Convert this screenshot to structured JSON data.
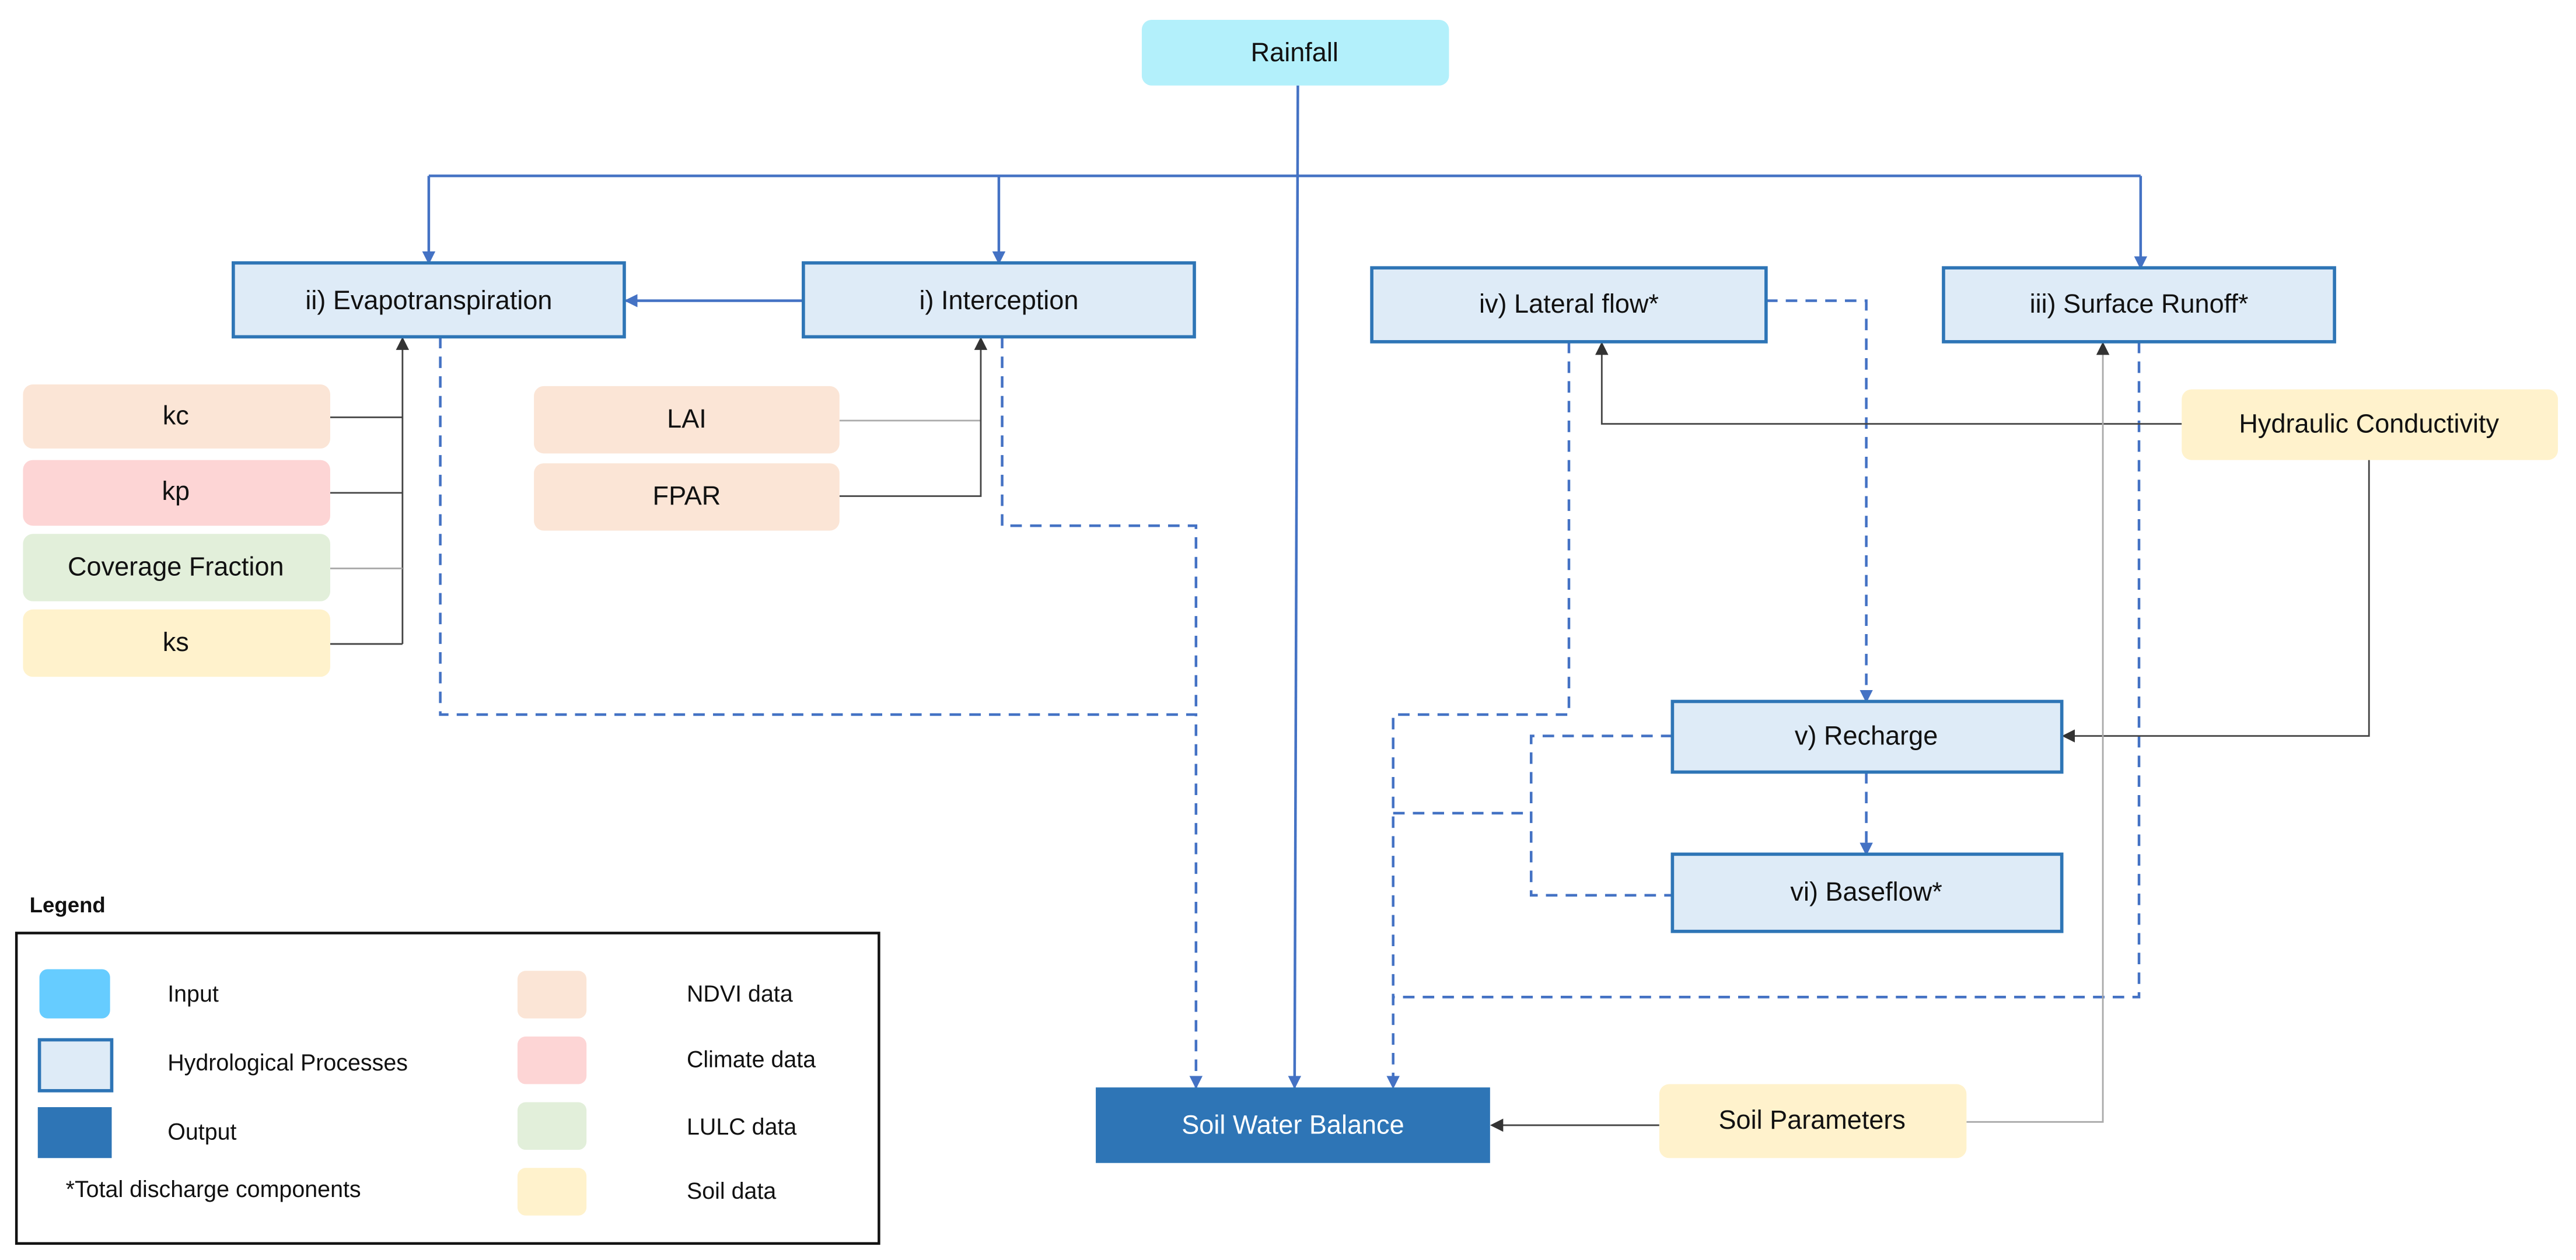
{
  "colors": {
    "input": "#66ccff",
    "rainfall": "#b3f0fb",
    "process_fill": "#deebf7",
    "process_stroke": "#2e75b6",
    "output": "#2e75b6",
    "ndvi": "#fbe5d6",
    "climate": "#fdd5d5",
    "lulc": "#e2efda",
    "soil": "#fff2cc",
    "flow_line": "#4472c4"
  },
  "nodes": {
    "rainfall": "Rainfall",
    "evapotranspiration": "ii) Evapotranspiration",
    "interception": "i) Interception",
    "lateral_flow": "iv) Lateral flow*",
    "surface_runoff": "iii) Surface Runoff*",
    "recharge": "v) Recharge",
    "baseflow": "vi) Baseflow*",
    "soil_water_balance": "Soil Water Balance",
    "kc": "kc",
    "kp": "kp",
    "coverage_fraction": "Coverage Fraction",
    "ks": "ks",
    "lai": "LAI",
    "fpar": "FPAR",
    "hydraulic_conductivity": "Hydraulic Conductivity",
    "soil_parameters": "Soil Parameters"
  },
  "legend": {
    "title": "Legend",
    "input": "Input",
    "processes": "Hydrological Processes",
    "output": "Output",
    "note": "*Total discharge components",
    "ndvi": "NDVI data",
    "climate": "Climate data",
    "lulc": "LULC data",
    "soil": "Soil data"
  }
}
